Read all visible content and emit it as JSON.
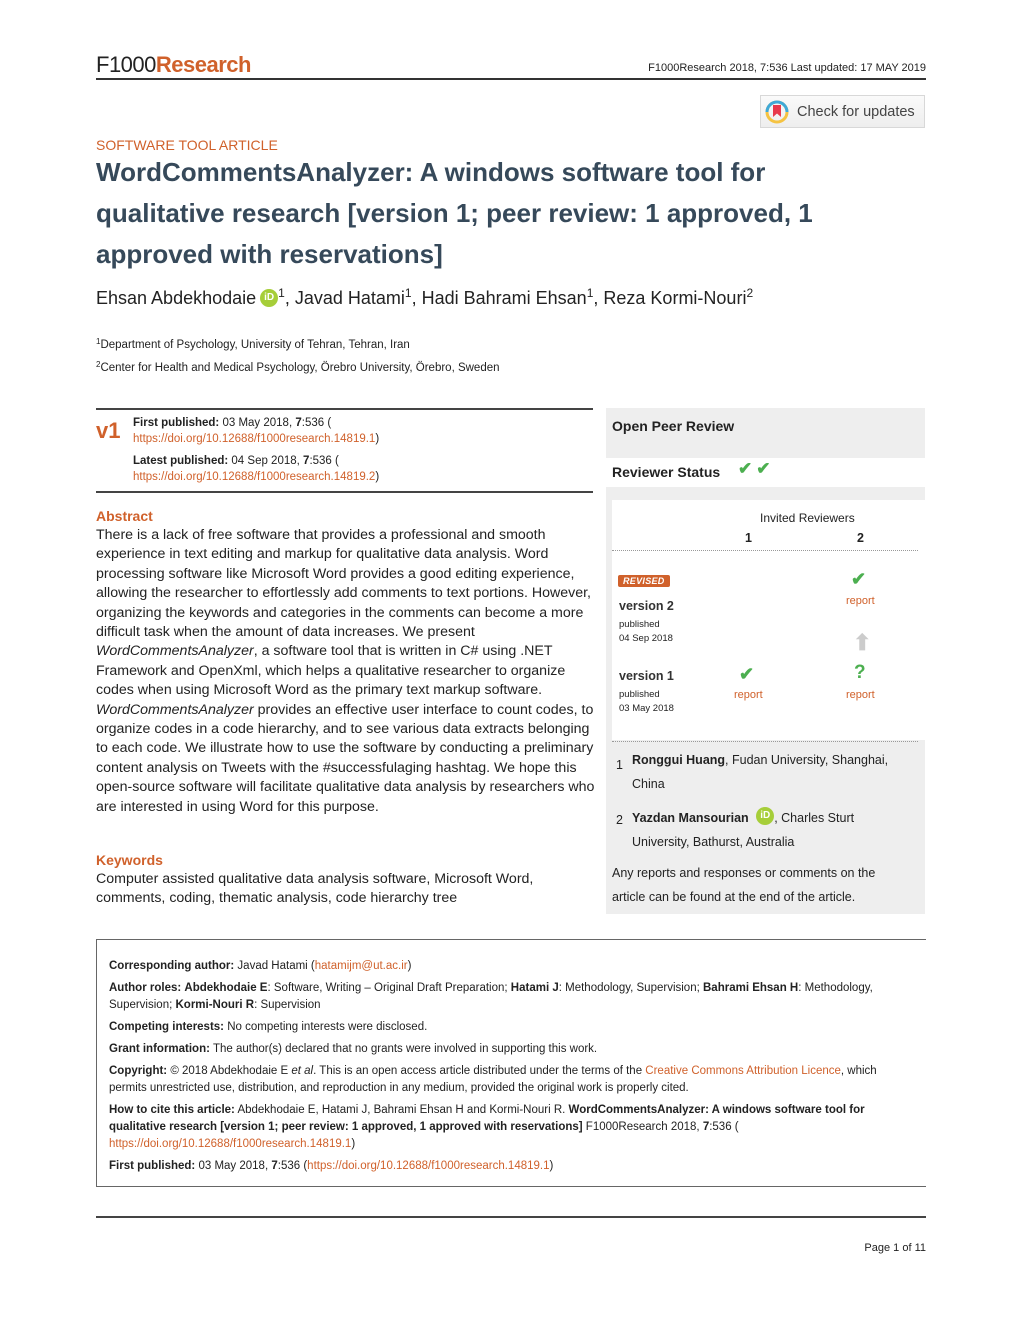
{
  "header": {
    "logo_part1": "F1000",
    "logo_part2": "Research",
    "meta": "F1000Research 2018, 7:536 Last updated: 17 MAY 2019",
    "check_updates_label": "Check for updates"
  },
  "article": {
    "type": "SOFTWARE TOOL ARTICLE",
    "title_main": "WordCommentsAnalyzer: A windows software tool for qualitative research",
    "title_status": "[version 1; peer review: 1 approved, 1 approved with reservations]",
    "authors": [
      {
        "name": "Ehsan Abdekhodaie",
        "affil": "1",
        "orcid": true
      },
      {
        "name": "Javad Hatami",
        "affil": "1",
        "orcid": false
      },
      {
        "name": "Hadi Bahrami Ehsan",
        "affil": "1",
        "orcid": false
      },
      {
        "name": "Reza Kormi-Nouri",
        "affil": "2",
        "orcid": false
      }
    ],
    "affiliations": [
      {
        "num": "1",
        "text": "Department of Psychology, University of Tehran, Tehran, Iran"
      },
      {
        "num": "2",
        "text": "Center for Health and Medical Psychology, Örebro University, Örebro, Sweden"
      }
    ]
  },
  "versions": {
    "badge": "v1",
    "first_published_label": "First published:",
    "first_published_value": "03 May 2018,",
    "first_published_vol": "7",
    "first_published_num": ":536 (",
    "first_published_doi": "https://doi.org/10.12688/f1000research.14819.1",
    "latest_published_label": "Latest published:",
    "latest_published_value": "04 Sep 2018,",
    "latest_published_vol": "7",
    "latest_published_num": ":536 (",
    "latest_published_doi": "https://doi.org/10.12688/f1000research.14819.2",
    "close_paren": ")"
  },
  "abstract": {
    "heading": "Abstract",
    "text_1": "There is a lack of free software that provides a professional and smooth experience in text editing and markup for qualitative data analysis. Word processing software like Microsoft Word provides a good editing experience, allowing the researcher to effortlessly add comments to text portions. However, organizing the keywords and categories in the comments can become a more difficult task when the amount of data increases. We present ",
    "italic_1": "WordCommentsAnalyzer",
    "text_2": ", a software tool that is written in C# using .NET Framework and OpenXml, which helps a qualitative researcher to organize codes when using Microsoft Word as the primary text markup software. ",
    "italic_2": "WordCommentsAnalyzer",
    "text_3": " provides an effective user interface to count codes, to organize codes in a code hierarchy, and to see various data extracts belonging to each code. We illustrate how to use the software by conducting a preliminary content analysis on Tweets with the #successfulaging hashtag. We hope this open-source software will facilitate qualitative data analysis by researchers who are interested in using Word for this purpose."
  },
  "keywords": {
    "heading": "Keywords",
    "text": "Computer assisted qualitative data analysis software, Microsoft Word, comments, coding, thematic analysis, code hierarchy tree"
  },
  "peer_review": {
    "title": "Open Peer Review",
    "status_label": "Reviewer Status",
    "status_checks": "✔✔",
    "invited_label": "Invited Reviewers",
    "reviewer_cols": [
      "1",
      "2"
    ],
    "revised_badge": "REVISED",
    "versions": [
      {
        "label": "version 2",
        "published": "published",
        "date": "04 Sep 2018",
        "reviews": [
          null,
          {
            "status": "approved",
            "icon": "✔",
            "link": "report"
          }
        ]
      },
      {
        "label": "version 1",
        "published": "published",
        "date": "03 May 2018",
        "reviews": [
          {
            "status": "approved",
            "icon": "✔",
            "link": "report"
          },
          {
            "status": "approved-with-reservations",
            "icon": "?",
            "link": "report"
          }
        ]
      }
    ],
    "arrow": "⬆",
    "reviewers": [
      {
        "num": "1",
        "name": "Ronggui Huang",
        "affil": ", Fudan University, Shanghai, China",
        "orcid": false
      },
      {
        "num": "2",
        "name": "Yazdan Mansourian",
        "affil": ", Charles Sturt University, Bathurst, Australia",
        "orcid": true
      }
    ],
    "note": "Any reports and responses or comments on the article can be found at the end of the article."
  },
  "info": {
    "corresponding_label": "Corresponding author:",
    "corresponding_name": "Javad Hatami (",
    "corresponding_email": "hatamijm@ut.ac.ir",
    "corresponding_close": ")",
    "roles_label": "Author roles:",
    "roles": [
      {
        "who": "Abdekhodaie E",
        "what": ": Software, Writing – Original Draft Preparation; "
      },
      {
        "who": "Hatami J",
        "what": ": Methodology, Supervision; "
      },
      {
        "who": "Bahrami Ehsan H",
        "what": ": Methodology, Supervision; "
      },
      {
        "who": "Kormi-Nouri R",
        "what": ": Supervision"
      }
    ],
    "competing_label": "Competing interests:",
    "competing_text": "No competing interests were disclosed.",
    "grant_label": "Grant information:",
    "grant_text": "The author(s) declared that no grants were involved in supporting this work.",
    "copyright_label": "Copyright:",
    "copyright_text_1": "© 2018 Abdekhodaie E ",
    "copyright_etal": "et al",
    "copyright_text_2": ". This is an open access article distributed under the terms of the ",
    "copyright_link": "Creative Commons Attribution Licence",
    "copyright_text_3": ", which permits unrestricted use, distribution, and reproduction in any medium, provided the original work is properly cited.",
    "cite_label": "How to cite this article:",
    "cite_authors": "Abdekhodaie E, Hatami J, Bahrami Ehsan H and Kormi-Nouri R. ",
    "cite_title": "WordCommentsAnalyzer: A windows software tool for qualitative research [version 1; peer review: 1 approved, 1 approved with reservations]",
    "cite_journal": " F1000Research 2018, ",
    "cite_vol": "7",
    "cite_num": ":536 (",
    "cite_doi": "https://doi.org/10.12688/f1000research.14819.1",
    "cite_close": ")",
    "first_label": "First published:",
    "first_text": "03 May 2018, ",
    "first_vol": "7",
    "first_num": ":536 (",
    "first_doi": "https://doi.org/10.12688/f1000research.14819.1",
    "first_close": ")"
  },
  "footer": {
    "page": "Page 1 of 11"
  }
}
